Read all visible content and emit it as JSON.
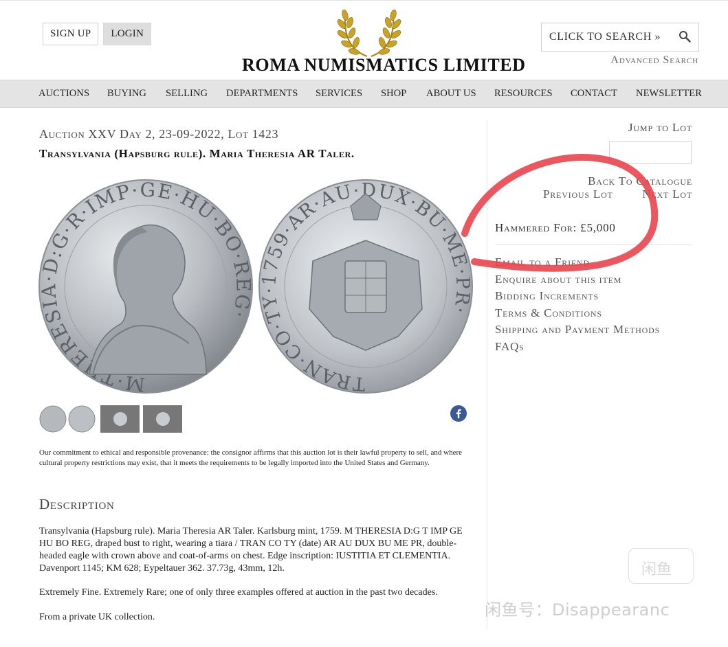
{
  "header": {
    "signup_label": "SIGN UP",
    "login_label": "LOGIN",
    "site_name": "ROMA NUMISMATICS LIMITED",
    "search_placeholder": "CLICK TO SEARCH »",
    "advanced_search": "Advanced Search"
  },
  "nav": {
    "items": [
      "AUCTIONS",
      "BUYING",
      "SELLING",
      "DEPARTMENTS",
      "SERVICES",
      "SHOP",
      "ABOUT US",
      "RESOURCES",
      "CONTACT",
      "NEWSLETTER"
    ]
  },
  "lot": {
    "auction_line": "Auction XXV Day 2, 23-09-2022, Lot 1423",
    "title": "Transylvania (Hapsburg rule). Maria Theresia AR Taler.",
    "obverse_legend": "M·THERESIA·D:G·R·IMP·GE·HU·BO·REG·",
    "reverse_legend": "TRAN·CO·TY·1759·AR·AU·DUX·BU·ME·PR·"
  },
  "commitment_text": "Our commitment to ethical and responsible provenance: the consignor affirms that this auction lot is their lawful property to sell, and where cultural property restrictions may exist, that it meets the requirements to be legally imported into the United States and Germany.",
  "description": {
    "heading": "Description",
    "p1": "Transylvania (Hapsburg rule). Maria Theresia AR Taler. Karlsburg mint, 1759. M THERESIA D:G T IMP GE HU BO REG, draped bust to right, wearing a tiara / TRAN CO TY (date) AR AU DUX BU ME PR, double-headed eagle with crown above and coat-of-arms on chest. Edge inscription: IUSTITIA ET CLEMENTIA. Davenport 1145; KM 628; Eypeltauer 362. 37.73g, 43mm, 12h.",
    "p2": "Extremely Fine. Extremely Rare; one of only three examples offered at auction in the past two decades.",
    "p3": "From a private UK collection."
  },
  "sidebar": {
    "jump_label": "Jump to Lot",
    "back_label": "Back To Catalogue",
    "prev_label": "Previous Lot",
    "next_label": "Next Lot",
    "hammer_label": "Hammered For: £5,000",
    "links": [
      "Email to a Friend",
      "Enquire about this item",
      "Bidding Increments",
      "Terms & Conditions",
      "Shipping and Payment Methods",
      "FAQs"
    ]
  },
  "watermark": {
    "badge": "闲鱼",
    "text": "闲鱼号：Disappearanc"
  },
  "colors": {
    "nav_bg": "#e4e4e4",
    "annotation_red": "#e8454d",
    "facebook_blue": "#3b5998",
    "wreath_gold": "#c9a227"
  }
}
